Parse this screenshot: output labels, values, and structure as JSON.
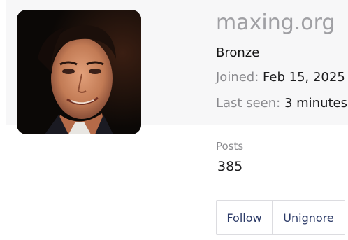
{
  "profile": {
    "username": "maxing.org",
    "title": "Bronze",
    "joined_label": "Joined:",
    "joined_value": "Feb 15, 2025",
    "last_seen_label": "Last seen:",
    "last_seen_value": "3 minutes"
  },
  "stats": {
    "posts_label": "Posts",
    "posts_value": "385"
  },
  "actions": {
    "follow_label": "Follow",
    "unignore_label": "Unignore"
  },
  "colors": {
    "username": "#a0a0a4",
    "button_text": "#2b3a67",
    "header_background": "#f7f7f8"
  }
}
